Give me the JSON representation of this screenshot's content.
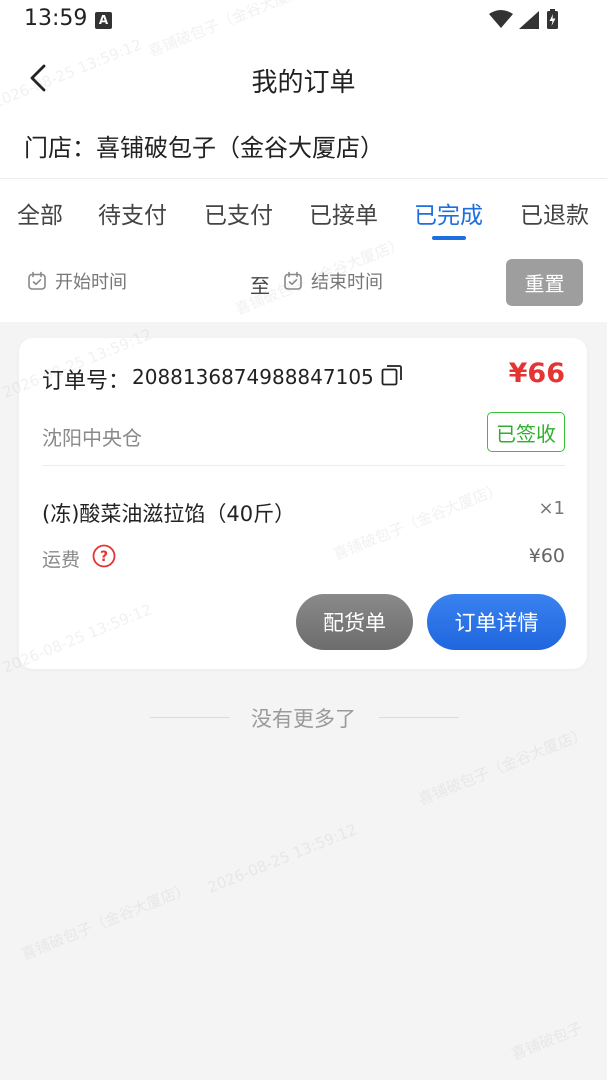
{
  "status_bar": {
    "time": "13:59",
    "notification_letter": "A"
  },
  "nav": {
    "title": "我的订单",
    "back_icon": "chevron-left-icon"
  },
  "store": {
    "text": "门店：喜铺破包子（金谷大厦店）"
  },
  "tabs": [
    {
      "label": "全部"
    },
    {
      "label": "待支付"
    },
    {
      "label": "已支付"
    },
    {
      "label": "已接单"
    },
    {
      "label": "已完成",
      "active": true
    },
    {
      "label": "已退款"
    }
  ],
  "filter": {
    "start_placeholder": "开始时间",
    "to_label": "至",
    "end_placeholder": "结束时间",
    "reset_label": "重置"
  },
  "order": {
    "number_label": "订单号：",
    "number": "2088136874988847105",
    "price": "¥66",
    "warehouse": "沈阳中央仓",
    "status": "已签收",
    "product_name": "(冻)酸菜油滋拉馅（40斤）",
    "product_qty": "×1",
    "freight_label": "运费",
    "freight_value": "¥60",
    "dispatch_button": "配货单",
    "detail_button": "订单详情"
  },
  "footer": {
    "no_more": "没有更多了"
  },
  "colors": {
    "accent": "#1d6fe0",
    "price": "#e43434",
    "status_green": "#37c237",
    "reset_gray": "#9e9e9e"
  }
}
